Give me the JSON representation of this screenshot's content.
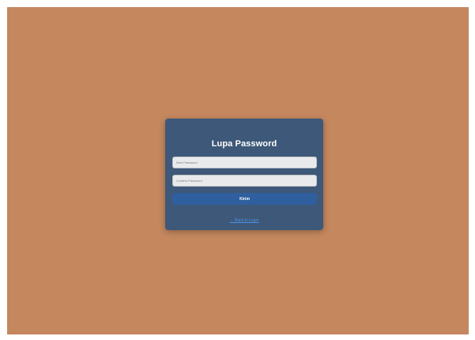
{
  "form": {
    "title": "Lupa Password",
    "new_password_placeholder": "New Password",
    "confirm_password_placeholder": "Confirm Password",
    "submit_label": "Kirim",
    "back_link": "← Back to Login"
  },
  "colors": {
    "page_background": "#c4875e",
    "card_background": "#3d5878",
    "button_background": "#2f5f9f",
    "link": "#4f8fe6"
  }
}
